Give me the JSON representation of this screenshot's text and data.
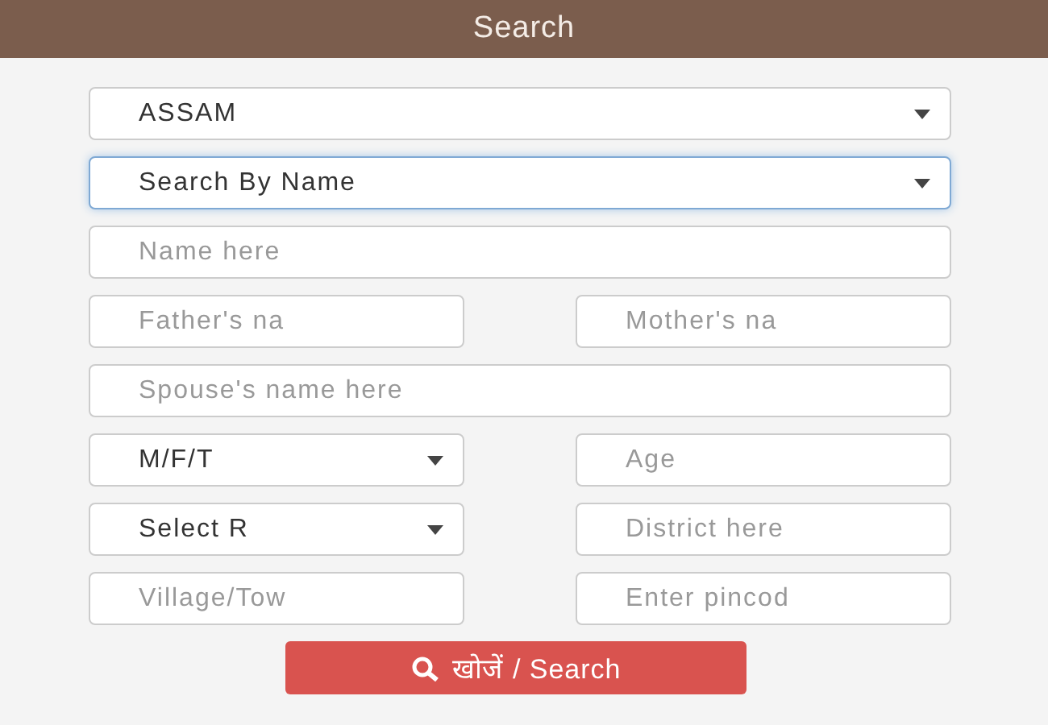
{
  "header": {
    "title": "Search"
  },
  "rows": [
    [
      {
        "kind": "select",
        "value": "ASSAM",
        "focused": false
      }
    ],
    [
      {
        "kind": "select",
        "value": "Search By Name",
        "focused": true
      }
    ],
    [
      {
        "kind": "input",
        "placeholder": "Name here",
        "focused": false
      }
    ],
    [
      {
        "kind": "input",
        "placeholder": "Father's na",
        "focused": false
      },
      {
        "kind": "input",
        "placeholder": "Mother's na",
        "focused": false
      }
    ],
    [
      {
        "kind": "input",
        "placeholder": "Spouse's name here",
        "focused": false
      }
    ],
    [
      {
        "kind": "select",
        "value": "M/F/T",
        "focused": false
      },
      {
        "kind": "input",
        "placeholder": "Age",
        "focused": false
      }
    ],
    [
      {
        "kind": "select",
        "value": "Select R",
        "focused": false
      },
      {
        "kind": "input",
        "placeholder": "District here",
        "focused": false
      }
    ],
    [
      {
        "kind": "input",
        "placeholder": "Village/Tow",
        "focused": false
      },
      {
        "kind": "input",
        "placeholder": "Enter pincod",
        "focused": false
      }
    ]
  ],
  "search_button": {
    "label": "खोजें / Search"
  }
}
